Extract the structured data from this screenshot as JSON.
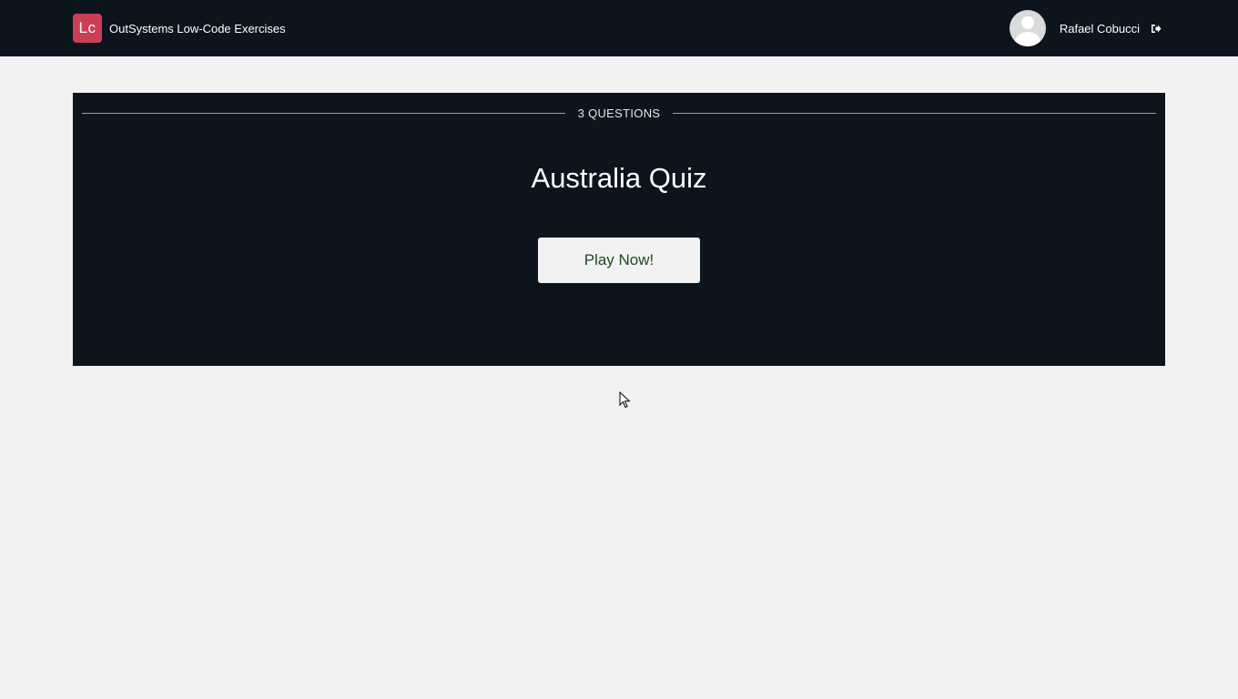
{
  "header": {
    "logo_text": "Lc",
    "app_title": "OutSystems Low-Code Exercises",
    "user_name": "Rafael Cobucci",
    "avatar_icon": "user-avatar-icon",
    "logout_icon": "logout-icon"
  },
  "quiz": {
    "questions_label": "3 QUESTIONS",
    "title": "Australia Quiz",
    "play_button_label": "Play Now!"
  },
  "colors": {
    "header_bg": "#0c141d",
    "card_bg": "#0c141d",
    "page_bg": "#f2f2f2",
    "logo_bg": "#c93f55",
    "button_text": "#1f4a1f"
  }
}
